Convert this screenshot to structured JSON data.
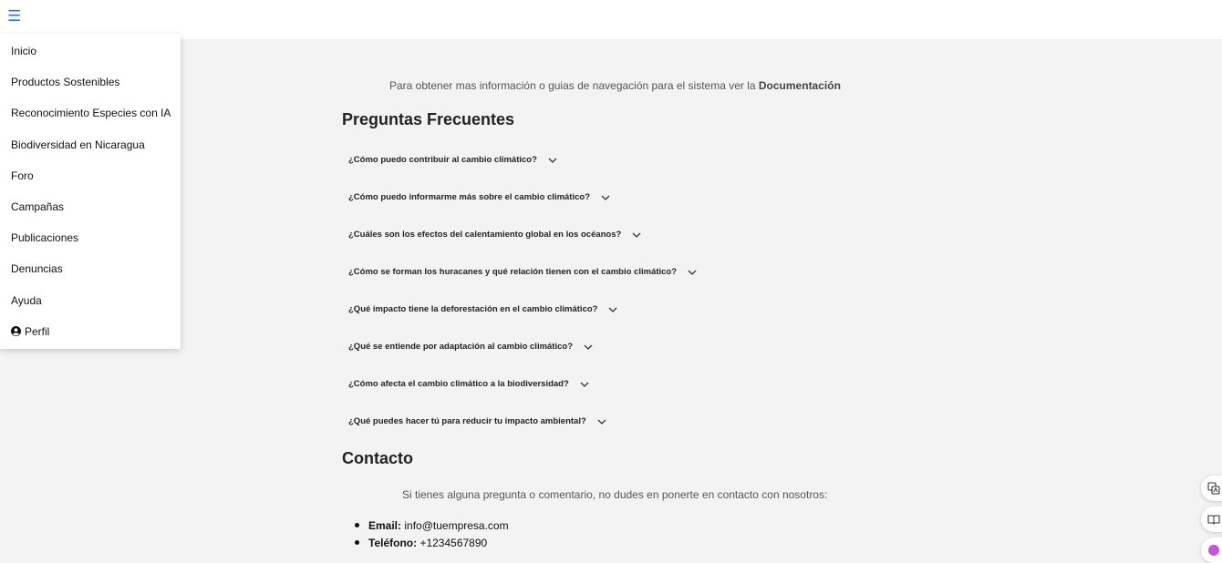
{
  "menu": {
    "items": [
      {
        "label": "Inicio"
      },
      {
        "label": "Productos Sostenibles"
      },
      {
        "label": "Reconocimiento Especies con IA"
      },
      {
        "label": "Biodiversidad en Nicaragua"
      },
      {
        "label": "Foro"
      },
      {
        "label": "Campañas"
      },
      {
        "label": "Publicaciones"
      },
      {
        "label": "Denuncias"
      },
      {
        "label": "Ayuda"
      },
      {
        "label": "Perfil",
        "icon": "user-circle-icon"
      }
    ]
  },
  "doc_note": {
    "text": "Para obtener mas información o guias de navegación para el sistema ver la ",
    "link": "Documentación"
  },
  "faq": {
    "title": "Preguntas Frecuentes",
    "questions": [
      "¿Cómo puedo contribuir al cambio climático?",
      "¿Cómo puedo informarme más sobre el cambio climático?",
      "¿Cuáles son los efectos del calentamiento global en los océanos?",
      "¿Cómo se forman los huracanes y qué relación tienen con el cambio climático?",
      "¿Qué impacto tiene la deforestación en el cambio climático?",
      "¿Qué se entiende por adaptación al cambio climático?",
      "¿Cómo afecta el cambio climático a la biodiversidad?",
      "¿Qué puedes hacer tú para reducir tu impacto ambiental?"
    ]
  },
  "contact": {
    "title": "Contacto",
    "intro": "Si tienes alguna pregunta o comentario, no dudes en ponerte en contacto con nosotros:",
    "email_label": "Email:",
    "email_value": "info@tuempresa.com",
    "phone_label": "Teléfono:",
    "phone_value": "+1234567890"
  },
  "colors": {
    "accent": "#2a7ae2",
    "page_bg": "#f3f3f3"
  }
}
